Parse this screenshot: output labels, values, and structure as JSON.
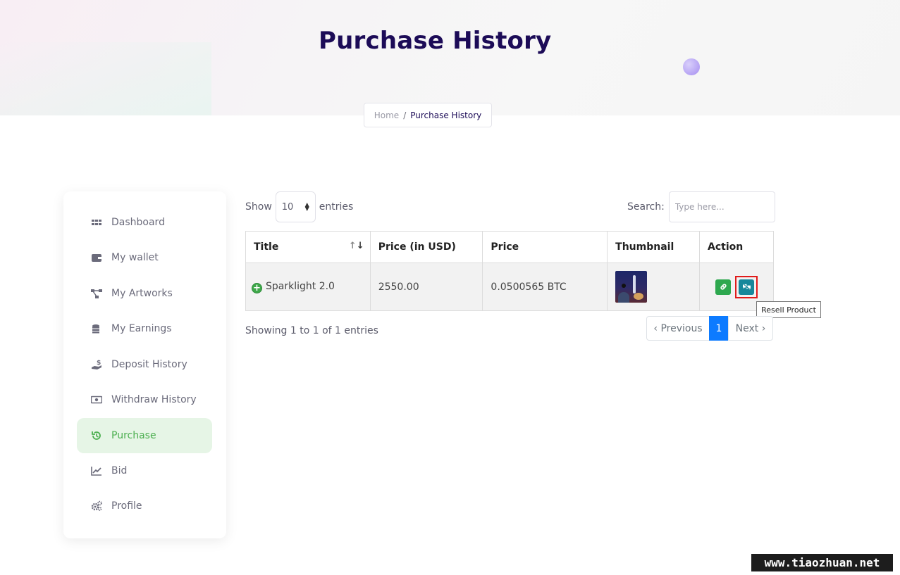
{
  "header": {
    "title": "Purchase History",
    "breadcrumb": {
      "home": "Home",
      "separator": "/",
      "current": "Purchase History"
    }
  },
  "sidebar": {
    "items": [
      {
        "label": "Dashboard",
        "icon": "grid-icon"
      },
      {
        "label": "My wallet",
        "icon": "wallet-icon"
      },
      {
        "label": "My Artworks",
        "icon": "network-icon"
      },
      {
        "label": "My Earnings",
        "icon": "coins-icon"
      },
      {
        "label": "Deposit History",
        "icon": "hand-dollar-icon"
      },
      {
        "label": "Withdraw History",
        "icon": "money-bill-icon"
      },
      {
        "label": "Purchase",
        "icon": "history-icon",
        "active": true
      },
      {
        "label": "Bid",
        "icon": "chart-line-icon"
      },
      {
        "label": "Profile",
        "icon": "cogs-icon"
      }
    ],
    "active_color": "#4caf50",
    "active_bg": "#e6f5e6"
  },
  "table_controls": {
    "show_label": "Show",
    "entries_value": "10",
    "entries_label": "entries",
    "search_label": "Search:",
    "search_placeholder": "Type here..."
  },
  "table": {
    "columns": [
      "Title",
      "Price (in USD)",
      "Price",
      "Thumbnail",
      "Action"
    ],
    "rows": [
      {
        "title": "Sparklight 2.0",
        "price_usd": "2550.00",
        "price": "0.0500565 BTC"
      }
    ]
  },
  "tooltip": "Resell Product",
  "footer": {
    "info": "Showing 1 to 1 of 1 entries",
    "prev": "‹ Previous",
    "page": "1",
    "next": "Next ›"
  },
  "watermark": "www.tiaozhuan.net",
  "colors": {
    "title": "#1c0b57",
    "link_button": "#2ea84f",
    "resell_button": "#17879b",
    "page_active": "#0d7bff",
    "highlight": "#e01b1b"
  }
}
